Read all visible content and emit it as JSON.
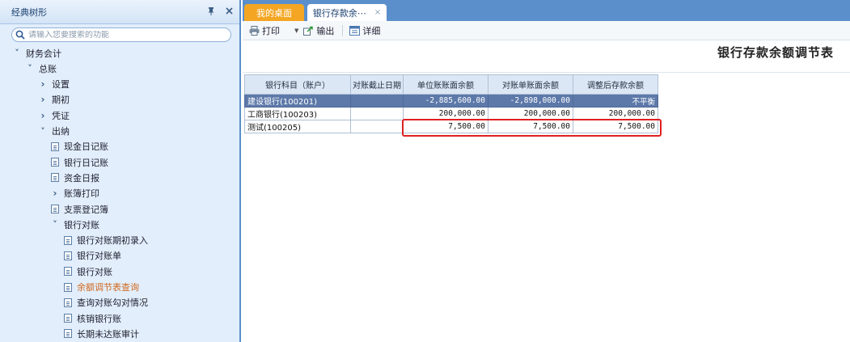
{
  "left_panel": {
    "title": "经典树形",
    "pin_icon": "pin-icon",
    "close_icon": "close-icon",
    "search": {
      "placeholder": "请输入您要搜索的功能"
    }
  },
  "tree": {
    "nodes": [
      {
        "label": "财务会计",
        "kind": "expanded"
      },
      {
        "label": "总账",
        "kind": "expanded"
      },
      {
        "label": "设置",
        "kind": "collapsed"
      },
      {
        "label": "期初",
        "kind": "collapsed"
      },
      {
        "label": "凭证",
        "kind": "collapsed"
      },
      {
        "label": "出纳",
        "kind": "expanded"
      },
      {
        "label": "现金日记账",
        "kind": "leaf"
      },
      {
        "label": "银行日记账",
        "kind": "leaf"
      },
      {
        "label": "资金日报",
        "kind": "leaf"
      },
      {
        "label": "账簿打印",
        "kind": "collapsed"
      },
      {
        "label": "支票登记簿",
        "kind": "leaf"
      },
      {
        "label": "银行对账",
        "kind": "expanded"
      },
      {
        "label": "银行对账期初录入",
        "kind": "leaf"
      },
      {
        "label": "银行对账单",
        "kind": "leaf"
      },
      {
        "label": "银行对账",
        "kind": "leaf"
      },
      {
        "label": "余额调节表查询",
        "kind": "leaf",
        "active": true
      },
      {
        "label": "查询对账勾对情况",
        "kind": "leaf"
      },
      {
        "label": "核销银行账",
        "kind": "leaf"
      },
      {
        "label": "长期未达账审计",
        "kind": "leaf"
      }
    ]
  },
  "tabs": {
    "home": "我的桌面",
    "report": "银行存款余⋯",
    "close": "×"
  },
  "toolbar": {
    "print": "打印",
    "export": "输出",
    "detail": "详细"
  },
  "report": {
    "title": "银行存款余额调节表",
    "columns": [
      "银行科目（账户）",
      "对账截止日期",
      "单位账账面余额",
      "对账单账面余额",
      "调整后存款余额"
    ],
    "rows": [
      {
        "account": "建设银行(100201)",
        "date": "",
        "book_balance": "-2,885,600.00",
        "statement_balance": "-2,898,000.00",
        "adjusted": "不平衡"
      },
      {
        "account": "工商银行(100203)",
        "date": "",
        "book_balance": "200,000.00",
        "statement_balance": "200,000.00",
        "adjusted": "200,000.00"
      },
      {
        "account": "测试(100205)",
        "date": "",
        "book_balance": "7,500.00",
        "statement_balance": "7,500.00",
        "adjusted": "7,500.00"
      }
    ]
  },
  "colors": {
    "tab_bar": "#5b8fcc",
    "home_tab": "#f4a623",
    "selected_row": "#5d79a9",
    "highlight": "#e02020",
    "active_tree_item": "#d2691e"
  }
}
